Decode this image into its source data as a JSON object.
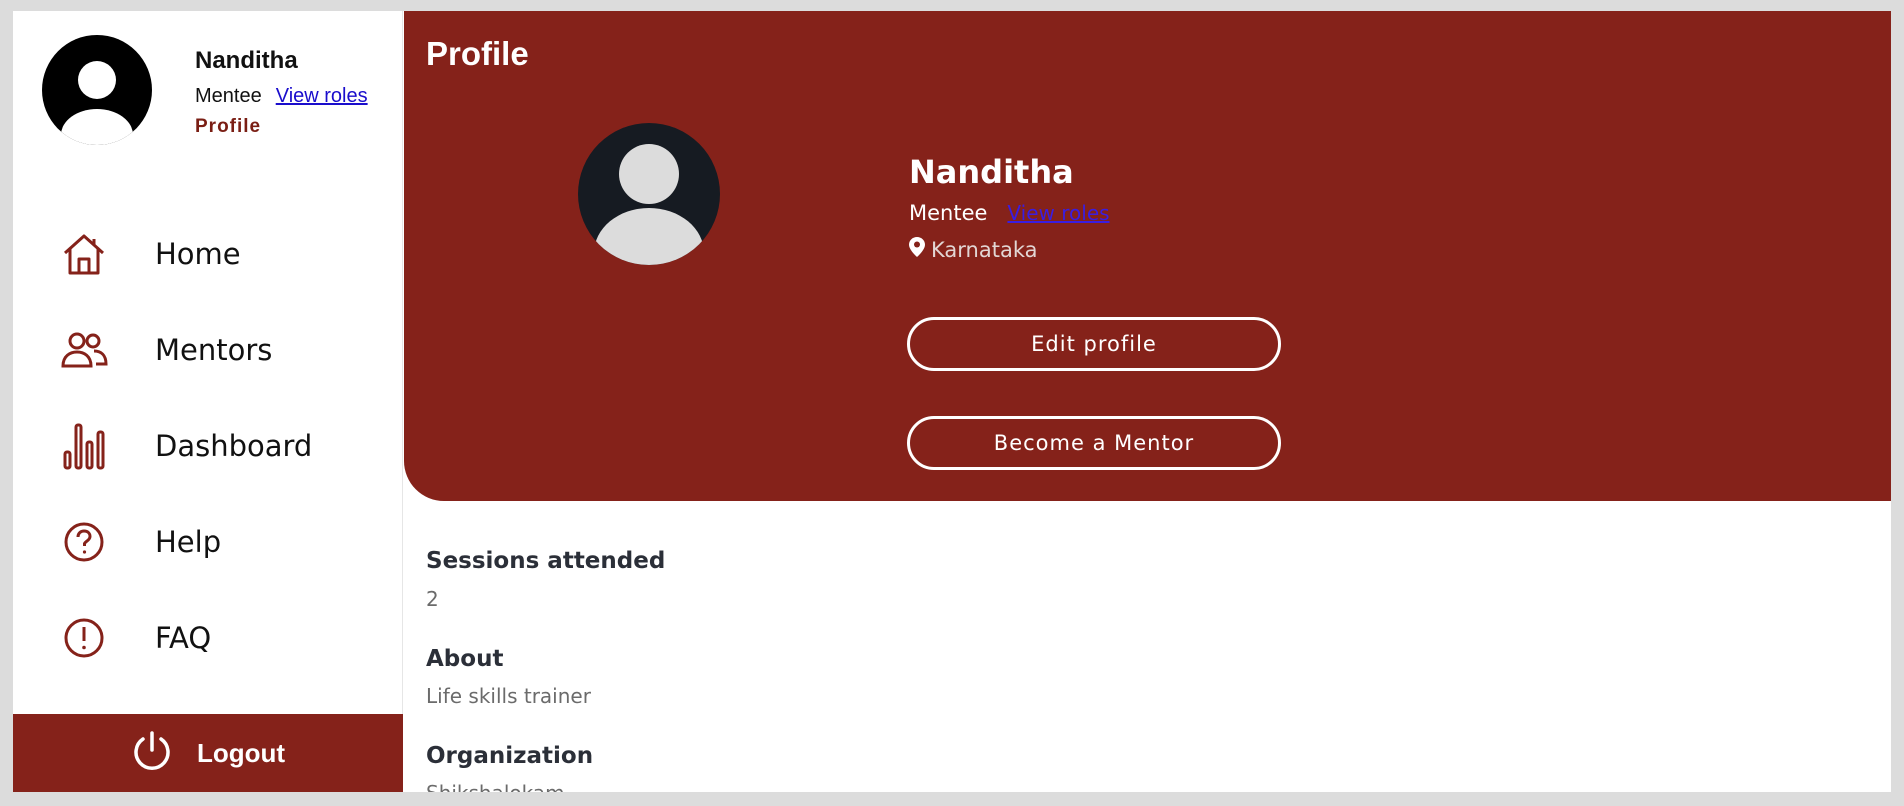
{
  "sidebar": {
    "user": {
      "name": "Nanditha",
      "role": "Mentee",
      "view_roles": "View roles",
      "profile_link": "Profile"
    },
    "nav": [
      {
        "label": "Home",
        "icon": "home-icon"
      },
      {
        "label": "Mentors",
        "icon": "users-icon"
      },
      {
        "label": "Dashboard",
        "icon": "bar-chart-icon"
      },
      {
        "label": "Help",
        "icon": "question-icon"
      },
      {
        "label": "FAQ",
        "icon": "exclamation-icon"
      }
    ],
    "logout_label": "Logout"
  },
  "main": {
    "title": "Profile",
    "profile": {
      "name": "Nanditha",
      "role": "Mentee",
      "view_roles": "View roles",
      "location": "Karnataka"
    },
    "buttons": {
      "edit_profile": "Edit profile",
      "become_mentor": "Become a Mentor"
    },
    "details": [
      {
        "label": "Sessions attended",
        "value": "2"
      },
      {
        "label": "About",
        "value": "Life skills trainer"
      },
      {
        "label": "Organization",
        "value": "Shikshalokam"
      }
    ]
  },
  "colors": {
    "brand": "#85221a",
    "link": "#1a0dcc",
    "text_dark": "#111111"
  }
}
